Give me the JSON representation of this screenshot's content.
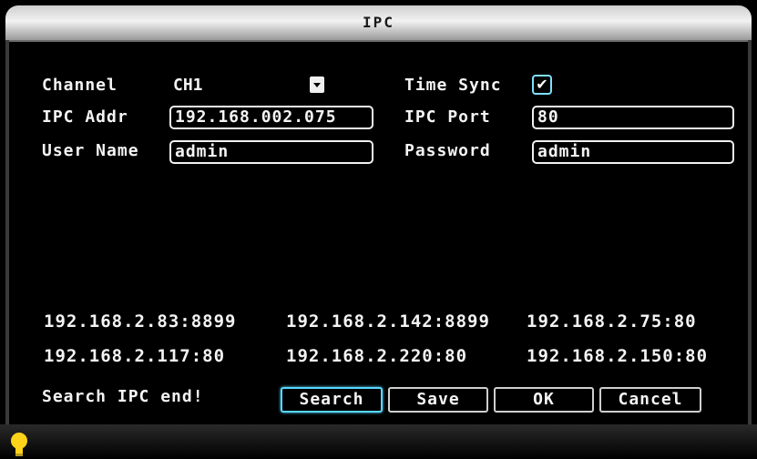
{
  "window": {
    "title": "IPC"
  },
  "form": {
    "channel_label": "Channel",
    "channel_value": "CH1",
    "time_sync_label": "Time Sync",
    "time_sync_checked": true,
    "ipc_addr_label": "IPC Addr",
    "ipc_addr_value": "192.168.002.075",
    "ipc_port_label": "IPC Port",
    "ipc_port_value": "80",
    "user_name_label": "User Name",
    "user_name_value": "admin",
    "password_label": "Password",
    "password_value": "admin"
  },
  "results": [
    "192.168.2.83:8899",
    "192.168.2.142:8899",
    "192.168.2.75:80",
    "192.168.2.117:80",
    "192.168.2.220:80",
    "192.168.2.150:80"
  ],
  "status": "Search IPC end!",
  "buttons": {
    "search": "Search",
    "save": "Save",
    "ok": "OK",
    "cancel": "Cancel"
  },
  "icons": {
    "checkbox": "check-icon",
    "dropdown": "chevron-down-icon",
    "status": "lightbulb-icon"
  },
  "colors": {
    "accent": "#58d7ff",
    "bulb": "#ffd21a"
  }
}
